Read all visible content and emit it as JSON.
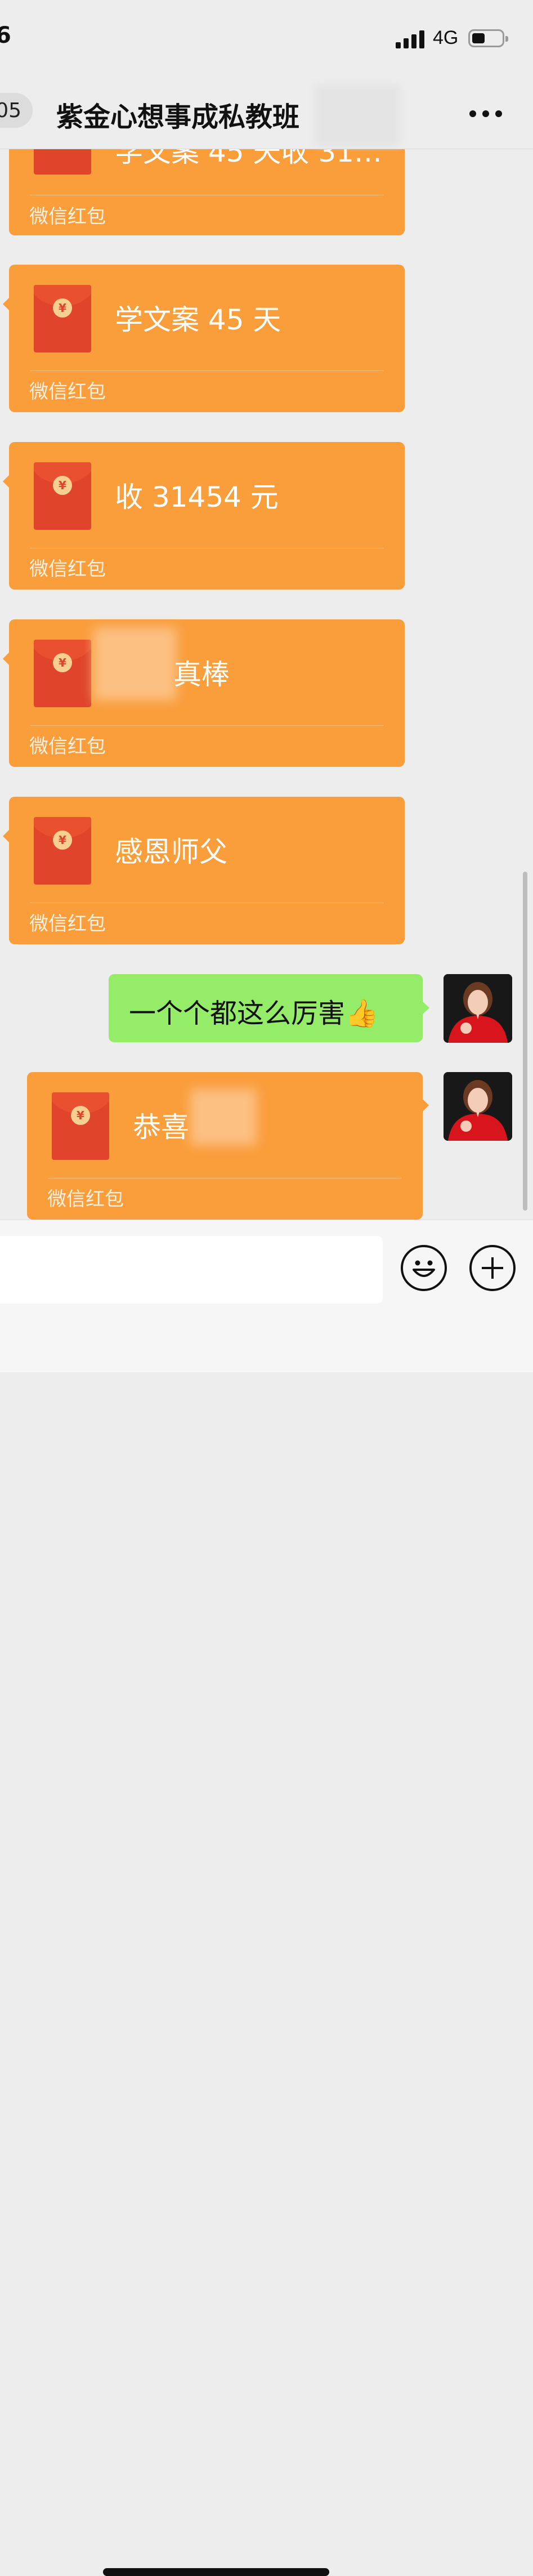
{
  "status_bar": {
    "time": "6",
    "network": "4G"
  },
  "nav": {
    "back_count": "05",
    "title": "紫金心想事成私教班"
  },
  "messages": [
    {
      "type": "red_packet",
      "text": "学文案 45 天收 31…",
      "label": "微信红包"
    },
    {
      "type": "red_packet",
      "text": "学文案 45 天",
      "label": "微信红包"
    },
    {
      "type": "red_packet",
      "text": "收 31454 元",
      "label": "微信红包"
    },
    {
      "type": "red_packet",
      "text": "真棒",
      "label": "微信红包"
    },
    {
      "type": "red_packet",
      "text": "感恩师父",
      "label": "微信红包"
    },
    {
      "type": "text",
      "text": "一个个都这么厉害👍"
    },
    {
      "type": "red_packet",
      "text": "恭喜",
      "label": "微信红包"
    }
  ],
  "colors": {
    "red_packet": "#fa9d3b",
    "self_bubble": "#95ec69",
    "background": "#ededed"
  }
}
